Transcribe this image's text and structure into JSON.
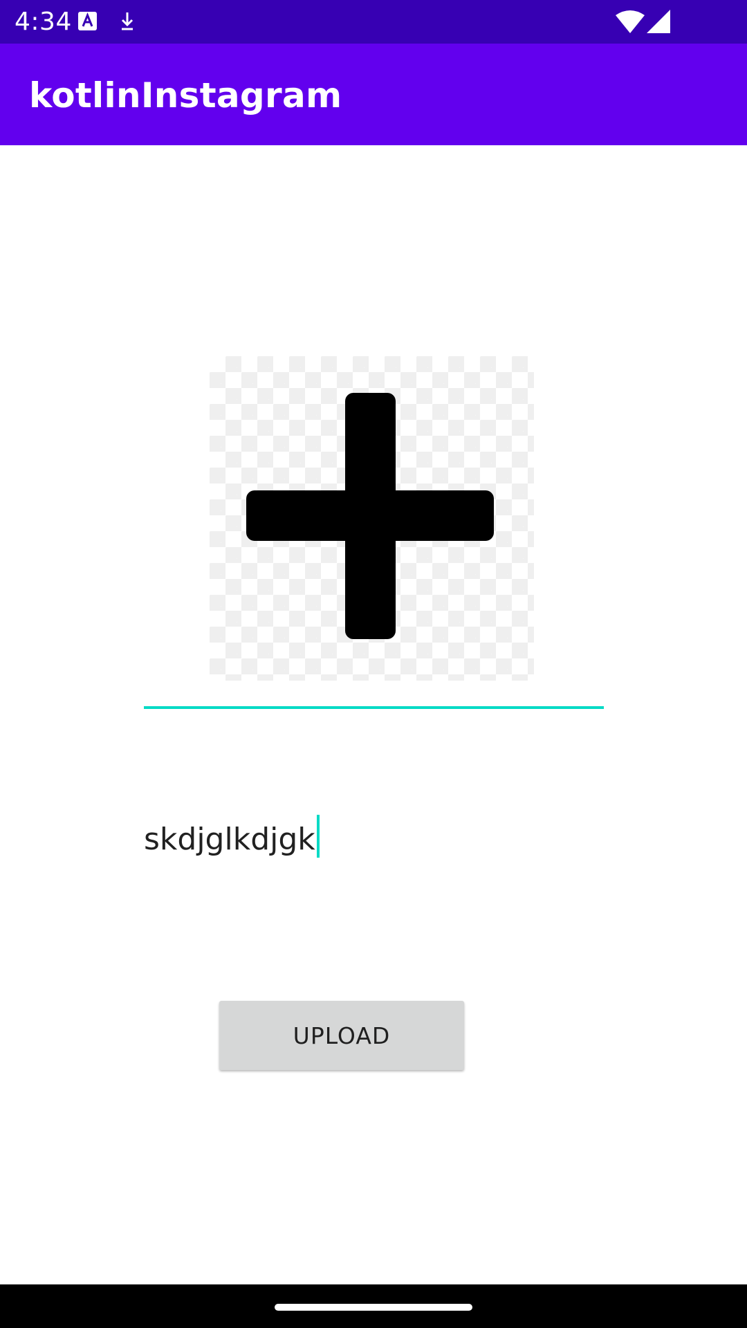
{
  "status_bar": {
    "time": "4:34",
    "icons": [
      "app-notification-icon",
      "download-notification-icon",
      "wifi-icon",
      "cellular-signal-icon"
    ]
  },
  "app_bar": {
    "title": "kotlinInstagram",
    "color": "#6200ee"
  },
  "image_picker": {
    "icon": "plus-icon",
    "background": "transparency-checkerboard"
  },
  "comment_input": {
    "value": "skdjglkdjgk",
    "focused": true,
    "accent_color": "#03dac5"
  },
  "upload_button": {
    "label": "UPLOAD"
  },
  "colors": {
    "status_bar": "#3700b3",
    "app_bar": "#6200ee",
    "accent": "#03dac5",
    "button_bg": "#d6d7d7"
  }
}
